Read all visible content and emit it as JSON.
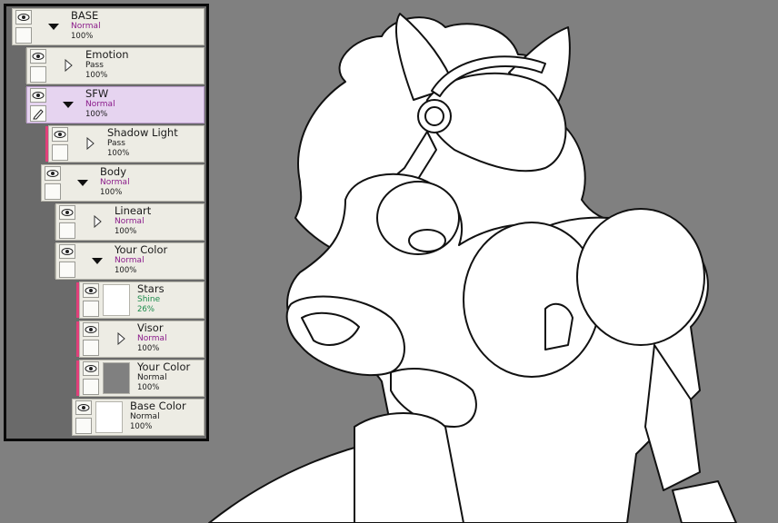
{
  "layers": [
    {
      "name": "BASE",
      "mode": "Normal",
      "opacity": "100%",
      "type": "folder",
      "expanded": true
    },
    {
      "name": "Emotion",
      "mode": "Pass",
      "opacity": "100%",
      "type": "folder",
      "expanded": false
    },
    {
      "name": "SFW",
      "mode": "Normal",
      "opacity": "100%",
      "type": "folder",
      "expanded": true,
      "selected": true
    },
    {
      "name": "Shadow Light",
      "mode": "Pass",
      "opacity": "100%",
      "type": "folder",
      "expanded": false
    },
    {
      "name": "Body",
      "mode": "Normal",
      "opacity": "100%",
      "type": "folder",
      "expanded": true
    },
    {
      "name": "Lineart",
      "mode": "Normal",
      "opacity": "100%",
      "type": "folder",
      "expanded": false
    },
    {
      "name": "Your Color",
      "mode": "Normal",
      "opacity": "100%",
      "type": "folder",
      "expanded": true
    },
    {
      "name": "Stars",
      "mode": "Shine",
      "opacity": "26%",
      "type": "layer",
      "thumb_color": "#ffffff"
    },
    {
      "name": "Visor",
      "mode": "Normal",
      "opacity": "100%",
      "type": "folder",
      "expanded": false
    },
    {
      "name": "Your Color",
      "mode": "Normal",
      "opacity": "100%",
      "type": "layer",
      "thumb_color": "#808080"
    },
    {
      "name": "Base Color",
      "mode": "Normal",
      "opacity": "100%",
      "type": "layer",
      "thumb_color": "#ffffff"
    }
  ],
  "colors": {
    "canvas_bg": "#808080",
    "selected_row": "#e6d4f0",
    "clip_marker": "#e0407a",
    "blend_mode_text": "#8a1a8a",
    "shine_text": "#1a8a4a"
  },
  "icons": {
    "visibility": "eye-icon",
    "edit": "pencil-icon",
    "folder_open": "triangle-down-icon",
    "folder_closed": "triangle-right-icon"
  }
}
